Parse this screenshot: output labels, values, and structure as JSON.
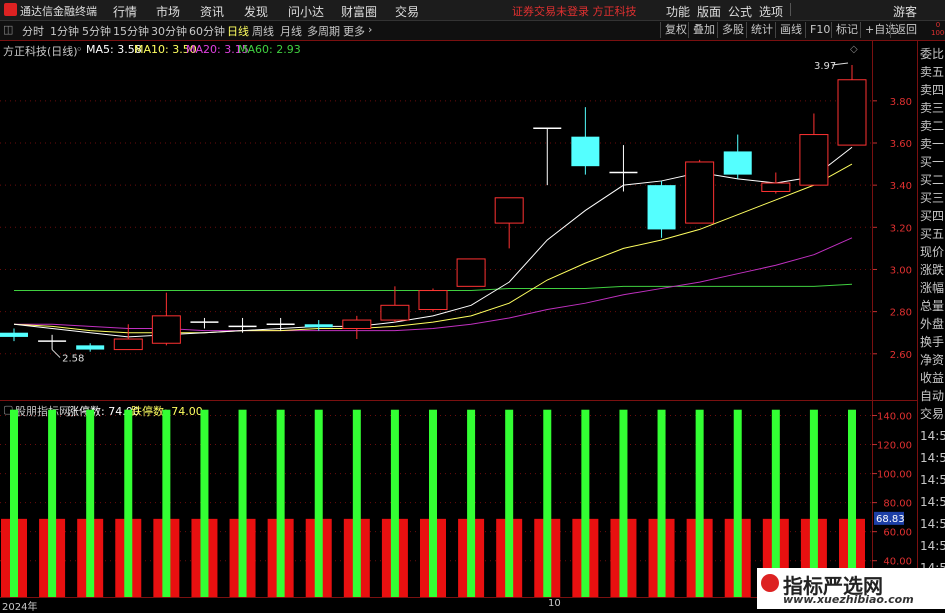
{
  "app": {
    "title": "通达信金融终端"
  },
  "menu": [
    "行情",
    "市场",
    "资讯",
    "发现",
    "问小达",
    "财富圈",
    "交易"
  ],
  "notice": "证券交易未登录   方正科技",
  "right_menu": [
    "功能",
    "版面",
    "公式",
    "选项"
  ],
  "guest": "游客",
  "periods": [
    "分时",
    "1分钟",
    "5分钟",
    "15分钟",
    "30分钟",
    "60分钟",
    "日线",
    "周线",
    "月线",
    "多周期",
    "更多"
  ],
  "active_period": "日线",
  "tools": [
    "复权",
    "叠加",
    "多股",
    "统计",
    "画线",
    "F10",
    "标记",
    "+自选",
    "返回"
  ],
  "main_chart": {
    "name": "方正科技(日线)",
    "ma": [
      {
        "label": "MA5: 3.58",
        "color": "#ffffff"
      },
      {
        "label": "MA10: 3.50",
        "color": "#ffff60"
      },
      {
        "label": "MA20: 3.15",
        "color": "#e040e0"
      },
      {
        "label": "MA60: 2.93",
        "color": "#40d040"
      }
    ],
    "high_label": "3.97",
    "low_label": "2.58",
    "y_ticks": [
      "3.80",
      "3.60",
      "3.40",
      "3.20",
      "3.00",
      "2.80",
      "2.60"
    ]
  },
  "sub_chart": {
    "name": "股朋指标网",
    "up_label": "涨停数: 74.00",
    "down_label": "跌停数: 74.00",
    "y_ticks": [
      "140.00",
      "120.00",
      "100.00",
      "80.00",
      "60.00",
      "40.00"
    ],
    "current_value": "68.83"
  },
  "right_panel": [
    "委比",
    "卖五",
    "卖四",
    "卖三",
    "卖二",
    "卖一",
    "买一",
    "买二",
    "买三",
    "买四",
    "买五",
    "现价",
    "涨跌",
    "涨幅",
    "总量",
    "外盘",
    "换手",
    "净资",
    "收益",
    "自动",
    "交易",
    "14:5",
    "14:5",
    "14:5",
    "14:5",
    "14:5",
    "14:5",
    "14:5",
    "14:5"
  ],
  "right_top_num": "0\n1000",
  "x_labels": [
    "2024年",
    "10"
  ],
  "watermark": {
    "line1": "指标严选网",
    "line2": "www.xuezhibiao.com"
  },
  "chart_data": {
    "type": "candlestick",
    "ylim": [
      2.55,
      4.05
    ],
    "candles": [
      {
        "o": 2.68,
        "h": 2.72,
        "l": 2.66,
        "c": 2.7,
        "color": "cyan"
      },
      {
        "o": 2.66,
        "h": 2.69,
        "l": 2.62,
        "c": 2.66,
        "color": "white"
      },
      {
        "o": 2.62,
        "h": 2.65,
        "l": 2.61,
        "c": 2.64,
        "color": "cyan"
      },
      {
        "o": 2.62,
        "h": 2.74,
        "l": 2.62,
        "c": 2.67,
        "color": "red"
      },
      {
        "o": 2.65,
        "h": 2.89,
        "l": 2.64,
        "c": 2.78,
        "color": "red"
      },
      {
        "o": 2.75,
        "h": 2.77,
        "l": 2.72,
        "c": 2.75,
        "color": "white"
      },
      {
        "o": 2.73,
        "h": 2.77,
        "l": 2.7,
        "c": 2.73,
        "color": "white"
      },
      {
        "o": 2.74,
        "h": 2.77,
        "l": 2.71,
        "c": 2.74,
        "color": "white"
      },
      {
        "o": 2.73,
        "h": 2.76,
        "l": 2.71,
        "c": 2.74,
        "color": "cyan"
      },
      {
        "o": 2.72,
        "h": 2.78,
        "l": 2.67,
        "c": 2.76,
        "color": "red"
      },
      {
        "o": 2.76,
        "h": 2.92,
        "l": 2.75,
        "c": 2.83,
        "color": "red"
      },
      {
        "o": 2.81,
        "h": 2.91,
        "l": 2.8,
        "c": 2.9,
        "color": "red"
      },
      {
        "o": 2.92,
        "h": 3.05,
        "l": 2.92,
        "c": 3.05,
        "color": "red"
      },
      {
        "o": 3.22,
        "h": 3.34,
        "l": 3.1,
        "c": 3.34,
        "color": "red"
      },
      {
        "o": 3.67,
        "h": 3.67,
        "l": 3.4,
        "c": 3.67,
        "color": "white"
      },
      {
        "o": 3.63,
        "h": 3.77,
        "l": 3.45,
        "c": 3.49,
        "color": "cyan"
      },
      {
        "o": 3.46,
        "h": 3.59,
        "l": 3.37,
        "c": 3.46,
        "color": "white"
      },
      {
        "o": 3.4,
        "h": 3.42,
        "l": 3.15,
        "c": 3.19,
        "color": "cyan"
      },
      {
        "o": 3.22,
        "h": 3.52,
        "l": 3.22,
        "c": 3.51,
        "color": "red"
      },
      {
        "o": 3.56,
        "h": 3.64,
        "l": 3.43,
        "c": 3.45,
        "color": "cyan"
      },
      {
        "o": 3.37,
        "h": 3.46,
        "l": 3.36,
        "c": 3.41,
        "color": "red"
      },
      {
        "o": 3.4,
        "h": 3.74,
        "l": 3.4,
        "c": 3.64,
        "color": "red"
      },
      {
        "o": 3.59,
        "h": 3.97,
        "l": 3.59,
        "c": 3.9,
        "color": "red"
      }
    ],
    "ma5": [
      2.74,
      2.72,
      2.7,
      2.68,
      2.69,
      2.7,
      2.71,
      2.72,
      2.73,
      2.73,
      2.75,
      2.78,
      2.83,
      2.94,
      3.14,
      3.28,
      3.4,
      3.42,
      3.46,
      3.43,
      3.41,
      3.44,
      3.58
    ],
    "ma10": [
      2.74,
      2.73,
      2.71,
      2.7,
      2.7,
      2.7,
      2.71,
      2.71,
      2.72,
      2.72,
      2.73,
      2.75,
      2.78,
      2.84,
      2.95,
      3.03,
      3.1,
      3.14,
      3.19,
      3.26,
      3.33,
      3.4,
      3.5
    ],
    "ma20": [
      2.74,
      2.74,
      2.73,
      2.72,
      2.72,
      2.71,
      2.71,
      2.71,
      2.71,
      2.71,
      2.71,
      2.72,
      2.74,
      2.77,
      2.81,
      2.84,
      2.88,
      2.91,
      2.94,
      2.98,
      3.02,
      3.07,
      3.15
    ],
    "ma60": [
      2.9,
      2.9,
      2.9,
      2.9,
      2.9,
      2.9,
      2.9,
      2.9,
      2.9,
      2.9,
      2.9,
      2.9,
      2.9,
      2.91,
      2.91,
      2.91,
      2.92,
      2.92,
      2.92,
      2.92,
      2.92,
      2.92,
      2.93
    ],
    "sub": {
      "ylim": [
        0,
        150
      ],
      "green": 74,
      "red": 68.83
    }
  }
}
